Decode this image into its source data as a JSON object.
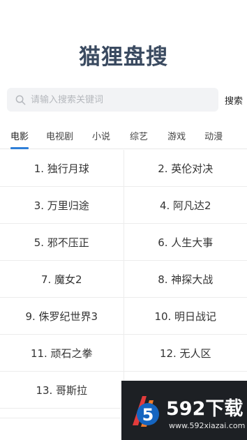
{
  "app": {
    "title": "猫狸盘搜"
  },
  "search": {
    "placeholder": "请输入搜索关键词",
    "value": "",
    "button_label": "搜索"
  },
  "tabs": [
    {
      "label": "电影",
      "active": true
    },
    {
      "label": "电视剧",
      "active": false
    },
    {
      "label": "小说",
      "active": false
    },
    {
      "label": "综艺",
      "active": false
    },
    {
      "label": "游戏",
      "active": false
    },
    {
      "label": "动漫",
      "active": false
    }
  ],
  "results": [
    "1. 独行月球",
    "2. 英伦对决",
    "3. 万里归途",
    "4. 阿凡达2",
    "5. 邪不压正",
    "6. 人生大事",
    "7. 魔女2",
    "8. 神探大战",
    "9. 侏罗纪世界3",
    "10. 明日战记",
    "11. 顽石之拳",
    "12. 无人区",
    "13. 哥斯拉",
    ""
  ],
  "watermark": {
    "brand": "592下载",
    "url": "www.592xiazai.com",
    "logo_digit": "5"
  },
  "colors": {
    "accent": "#2f7fd8",
    "title": "#3a4a60",
    "search_bg": "#f2f3f5"
  }
}
